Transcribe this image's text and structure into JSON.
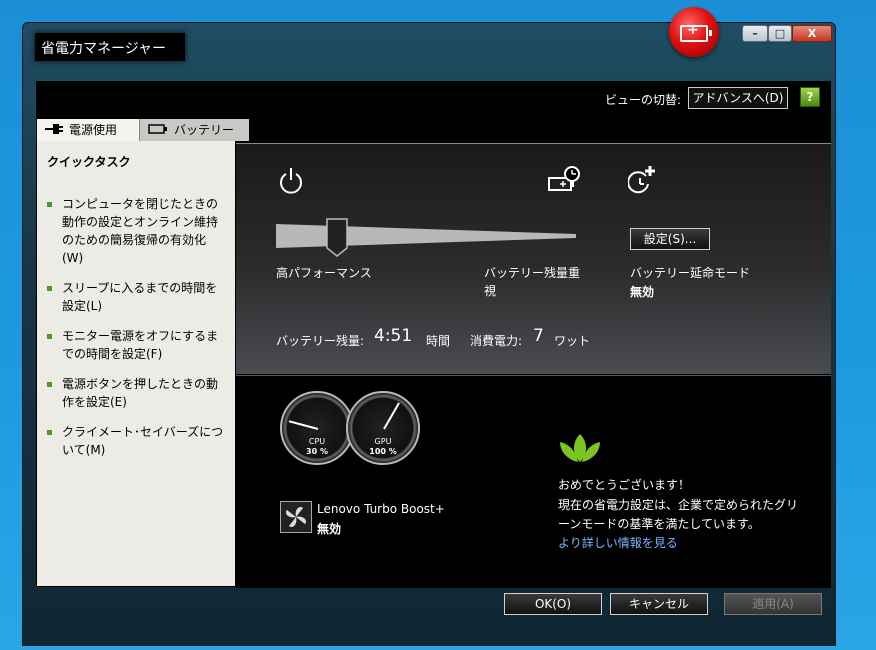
{
  "window": {
    "title": "省電力マネージャー",
    "min": "–",
    "max": "□",
    "close": "X"
  },
  "header": {
    "view_label": "ビューの切替:",
    "view_button": "アドバンスへ(D)",
    "help": "?"
  },
  "tabs": [
    {
      "label": "電源使用"
    },
    {
      "label": "バッテリー"
    }
  ],
  "sidebar": {
    "heading": "クイックタスク",
    "items": [
      {
        "label": "コンピュータを閉じたときの動作の設定とオンライン維持のための簡易復帰の有効化(W)"
      },
      {
        "label": "スリープに入るまでの時間を設定(L)"
      },
      {
        "label": "モニター電源をオフにするまでの時間を設定(F)"
      },
      {
        "label": "電源ボタンを押したときの動作を設定(E)"
      },
      {
        "label": "クライメート･セイバーズについて(M)"
      }
    ]
  },
  "power": {
    "left_label": "高パフォーマンス",
    "mid_label": "バッテリー残量重視",
    "slider_position": 0.2,
    "extend_label": "バッテリー延命モード",
    "extend_state": "無効",
    "settings_button": "設定(S)...",
    "remaining_label": "バッテリー残量:",
    "remaining_value": "4:51",
    "remaining_unit": "時間",
    "consumption_label": "消費電力:",
    "consumption_value": "7",
    "consumption_unit": "ワット"
  },
  "gauges": [
    {
      "name": "CPU",
      "value": "30 %"
    },
    {
      "name": "GPU",
      "value": "100 %"
    }
  ],
  "turbo": {
    "name": "Lenovo Turbo Boost+",
    "state": "無効"
  },
  "eco": {
    "title": "おめでとうございます！",
    "text": "現在の省電力設定は、企業で定められたグリーンモードの基準を満たしています。",
    "link": "より詳しい情報を見る"
  },
  "footer": {
    "ok": "OK(O)",
    "cancel": "キャンセル",
    "apply": "適用(A)"
  }
}
